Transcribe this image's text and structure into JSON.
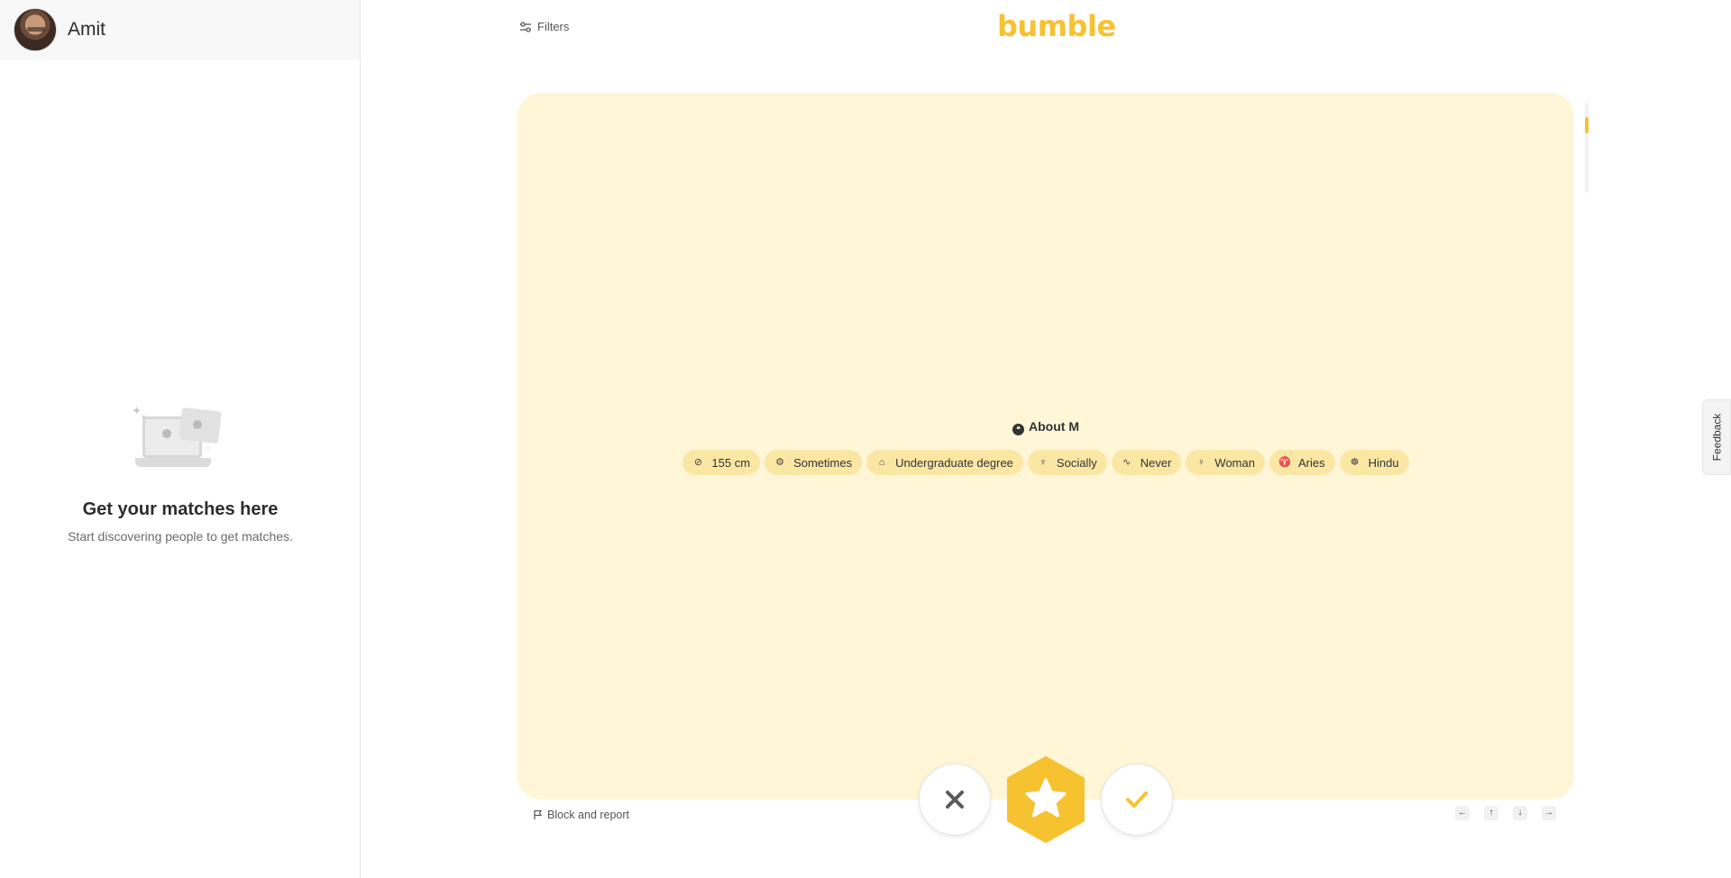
{
  "user": {
    "name": "Amit"
  },
  "empty_state": {
    "title": "Get your matches here",
    "subtitle": "Start discovering people to get matches."
  },
  "header": {
    "filters_label": "Filters",
    "logo_text": "bumble",
    "brand_color": "#f6c230"
  },
  "profile": {
    "about_title": "About M",
    "chips": [
      {
        "icon": "ruler-icon",
        "label": "155 cm"
      },
      {
        "icon": "dumbbell-icon",
        "label": "Sometimes"
      },
      {
        "icon": "graduation-cap-icon",
        "label": "Undergraduate degree"
      },
      {
        "icon": "wine-glass-icon",
        "label": "Socially"
      },
      {
        "icon": "cigarette-icon",
        "label": "Never"
      },
      {
        "icon": "woman-icon",
        "label": "Woman"
      },
      {
        "icon": "zodiac-icon",
        "label": "Aries"
      },
      {
        "icon": "religion-icon",
        "label": "Hindu"
      }
    ]
  },
  "footer": {
    "block_report_label": "Block and report",
    "keys": [
      "←",
      "↑",
      "↓",
      "→"
    ]
  },
  "feedback": {
    "label": "Feedback"
  }
}
